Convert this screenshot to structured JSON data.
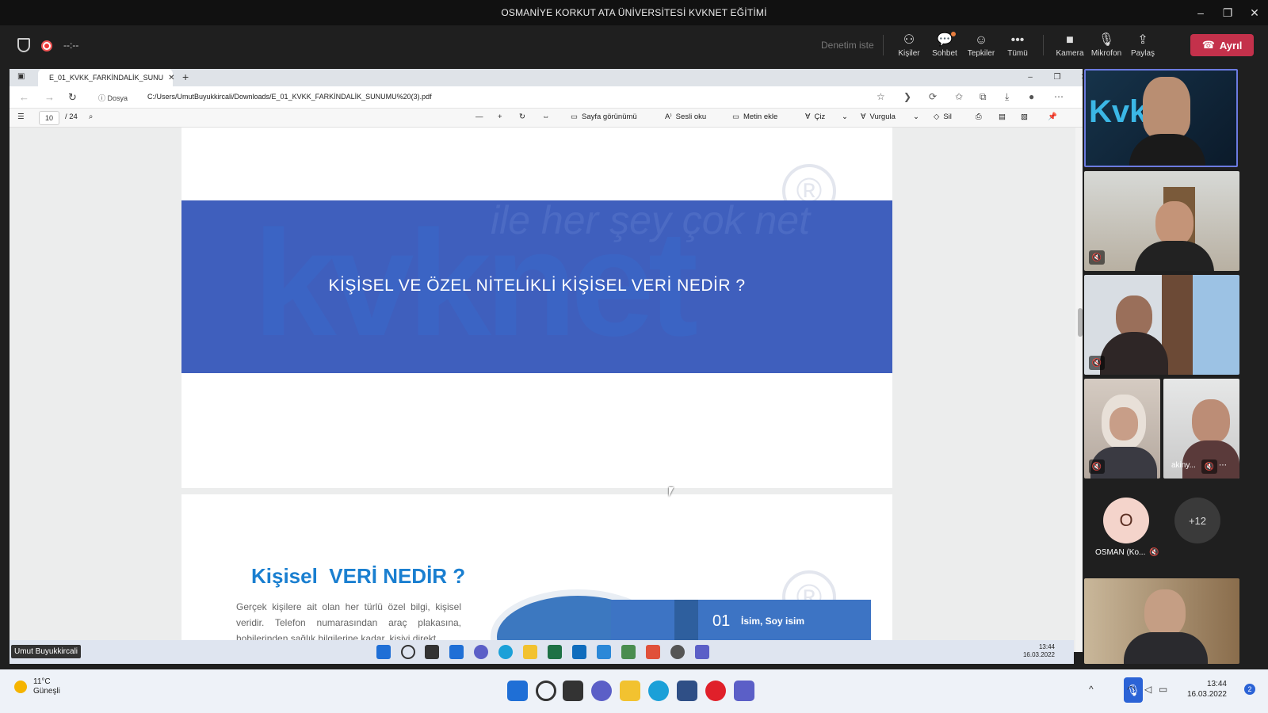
{
  "meeting": {
    "title": "OSMANİYE KORKUT ATA ÜNİVERSİTESİ KVKNET EĞİTİMİ",
    "timer": "--:--",
    "request_control": "Denetim iste",
    "buttons": {
      "people": "Kişiler",
      "chat": "Sohbet",
      "reactions": "Tepkiler",
      "more": "Tümü",
      "camera": "Kamera",
      "mic": "Mikrofon",
      "share": "Paylaş",
      "leave": "Ayrıl"
    }
  },
  "browser": {
    "tab_title": "E_01_KVKK_FARKİNDALİK_SUNU",
    "address_label": "Dosya",
    "url": "C:/Users/UmutBuyukkircali/Downloads/E_01_KVKK_FARKİNDALİK_SUNUMU%20(3).pdf"
  },
  "pdf_toolbar": {
    "current_page": "10",
    "total_pages": "/ 24",
    "page_view": "Sayfa görünümü",
    "read_aloud": "Sesli oku",
    "add_text": "Metin ekle",
    "draw": "Çiz",
    "highlight": "Vurgula",
    "erase": "Sil"
  },
  "slide1": {
    "heading": "KİŞİSEL VE ÖZEL NİTELİKLİ KİŞİSEL VERİ NEDİR ?",
    "watermark": "kvknet",
    "watermark_tagline": "ile her şey çok net"
  },
  "slide2": {
    "heading_part1": "Kişisel",
    "heading_part2": "VERİ NEDİR ?",
    "paragraph": "Gerçek kişilere ait olan her türlü özel bilgi, kişisel veridir. Telefon numarasından araç plakasına, hobilerinden sağlık bilgilerine kadar, kişiyi direkt",
    "item_number": "01",
    "item_label": "İsim, Soy isim"
  },
  "presenter_name": "Umut Buyukkircali",
  "inner_clock": {
    "time": "13:44",
    "date": "16.03.2022"
  },
  "participants": {
    "avatar_initial": "O",
    "avatar_name": "OSMAN (Ko...",
    "overflow": "+12",
    "video_label": "akiny..."
  },
  "taskbar": {
    "temperature": "11°C",
    "weather": "Güneşli",
    "time": "13:44",
    "date": "16.03.2022",
    "notifications": "2"
  },
  "colors": {
    "slide_blue": "#3f5fbd",
    "leave_red": "#c4314b",
    "heading_blue": "#1a7fd0"
  }
}
